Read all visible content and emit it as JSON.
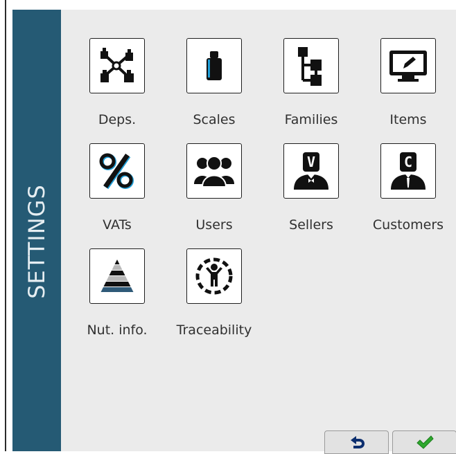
{
  "sidebar": {
    "title": "SETTINGS"
  },
  "tiles": [
    {
      "label": "Deps.",
      "icon": "departments-icon"
    },
    {
      "label": "Scales",
      "icon": "scale-icon"
    },
    {
      "label": "Families",
      "icon": "families-tree-icon"
    },
    {
      "label": "Items",
      "icon": "items-monitor-icon"
    },
    {
      "label": "VATs",
      "icon": "percent-icon"
    },
    {
      "label": "Users",
      "icon": "users-icon"
    },
    {
      "label": "Sellers",
      "icon": "seller-icon"
    },
    {
      "label": "Customers",
      "icon": "customer-icon"
    },
    {
      "label": "Nut. info.",
      "icon": "nutrition-pyramid-icon"
    },
    {
      "label": "Traceability",
      "icon": "traceability-icon"
    }
  ],
  "footer": {
    "back_icon": "back-arrow-icon",
    "confirm_icon": "checkmark-icon",
    "accent": "#255a74",
    "confirm_color": "#2ea82e"
  }
}
